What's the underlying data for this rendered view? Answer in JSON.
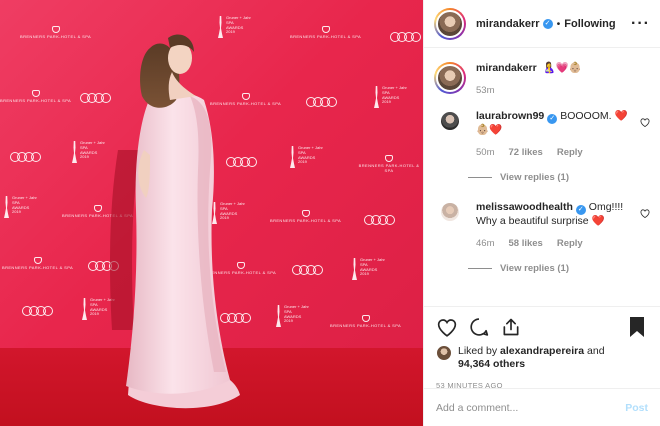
{
  "post": {
    "author": "mirandakerr",
    "follow_status": "Following",
    "more_icon": "more-icon",
    "caption": {
      "username": "mirandakerr",
      "text": "🤱💗👶🏼",
      "time": "53m"
    },
    "comments": [
      {
        "username": "laurabrown99",
        "text": "BOOOOM. ❤️👶🏼❤️",
        "time": "50m",
        "likes": "72 likes",
        "reply_label": "Reply",
        "view_replies": "View replies (1)"
      },
      {
        "username": "melissawoodhealth",
        "text": "Omg!!!! Why a beautiful surprise ❤️",
        "time": "46m",
        "likes": "58 likes",
        "reply_label": "Reply",
        "view_replies": "View replies (1)"
      }
    ],
    "liked_by": "Liked by",
    "liked_by_user": "alexandrapereira",
    "liked_and": "and",
    "likes_count": "94,364 others",
    "timestamp": "53 MINUTES AGO",
    "add_comment_placeholder": "Add a comment...",
    "post_label": "Post"
  },
  "photo": {
    "alt_icon": "photo",
    "wall_text": {
      "hotel": "BRENNERS PARK-HOTEL & SPA",
      "award_line1": "Gruner + Jahr",
      "award_line2": "SPA",
      "award_line3": "AWARDS",
      "award_line4": "2019"
    }
  },
  "colors": {
    "accent_blue": "#3897f0",
    "heart_red": "#ed4956",
    "wall_red": "#e8264c",
    "post_disabled": "#b2dffc"
  }
}
